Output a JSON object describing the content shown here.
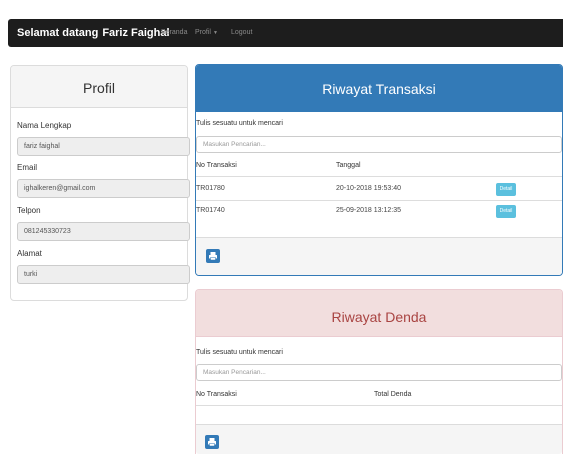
{
  "navbar": {
    "greeting": "Selamat datang",
    "username": "Fariz Faighal",
    "links": [
      "Beranda",
      "Profil",
      "Logout"
    ],
    "profil_caret": "▼"
  },
  "profil": {
    "title": "Profil",
    "fields": [
      {
        "label": "Nama Lengkap",
        "value": "fariz faighal"
      },
      {
        "label": "Email",
        "value": "ighalkeren@gmail.com"
      },
      {
        "label": "Telpon",
        "value": "081245330723"
      },
      {
        "label": "Alamat",
        "value": "turki"
      }
    ]
  },
  "transaksi": {
    "title": "Riwayat Transaksi",
    "search_label": "Tulis sesuatu untuk mencari",
    "search_placeholder": "Masukan Pencarian...",
    "columns": [
      "No Transaksi",
      "Tanggal"
    ],
    "rows": [
      {
        "no": "TR01780",
        "tanggal": "20-10-2018 19:53:40",
        "action": "Detail"
      },
      {
        "no": "TR01740",
        "tanggal": "25-09-2018 13:12:35",
        "action": "Detail"
      }
    ]
  },
  "denda": {
    "title": "Riwayat Denda",
    "search_label": "Tulis sesuatu untuk mencari",
    "search_placeholder": "Masukan Pencarian...",
    "columns": [
      "No Transaksi",
      "Total Denda"
    ]
  },
  "colors": {
    "navbar_bg": "#1d1d1d",
    "primary": "#337ab7",
    "danger_bg": "#f2dede",
    "info": "#5bc0de"
  },
  "icons": {
    "print": "print-icon"
  }
}
